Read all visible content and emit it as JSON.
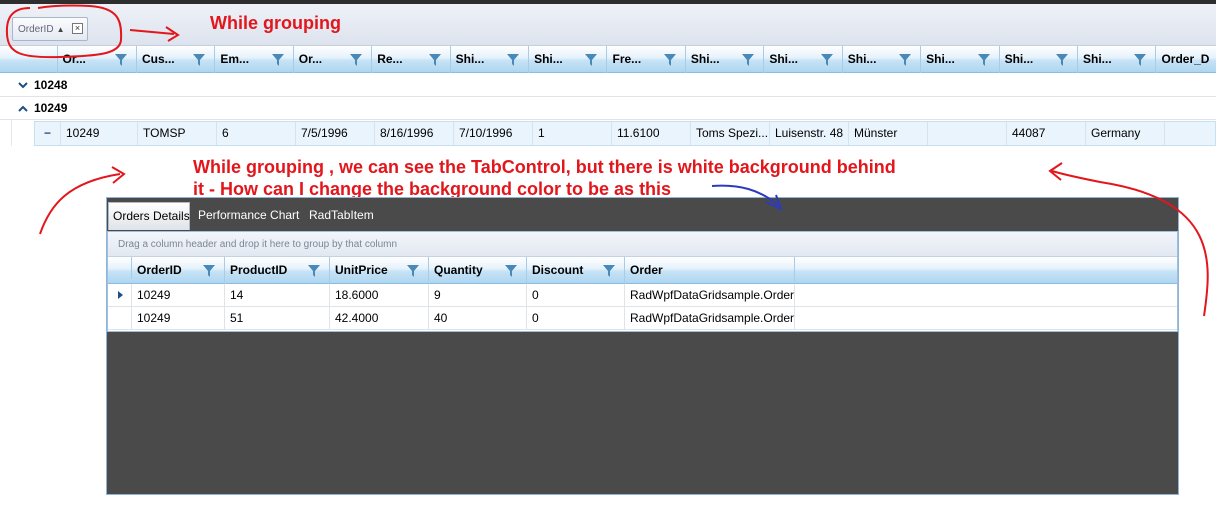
{
  "group_panel": {
    "chip_label": "OrderID",
    "chip_close": "×"
  },
  "columns": [
    "Or...",
    "Cus...",
    "Em...",
    "Or...",
    "Re...",
    "Shi...",
    "Shi...",
    "Fre...",
    "Shi...",
    "Shi...",
    "Shi...",
    "Shi...",
    "Shi...",
    "Shi...",
    "Order_D"
  ],
  "groups": [
    {
      "label": "10248",
      "expanded": false
    },
    {
      "label": "10249",
      "expanded": true
    }
  ],
  "expand_toggle": "−",
  "row": [
    "10249",
    "TOMSP",
    "6",
    "7/5/1996",
    "8/16/1996",
    "7/10/1996",
    "1",
    "11.6100",
    "Toms Spezi...",
    "Luisenstr. 48",
    "Münster",
    "",
    "44087",
    "Germany"
  ],
  "annotations": {
    "while_grouping": "While grouping",
    "question_line1": "While grouping , we can see the TabControl, but there is white background behind",
    "question_line2": "it - How can I change the background color to be as this"
  },
  "tabs": [
    "Orders Details",
    "Performance Chart",
    "RadTabItem"
  ],
  "inner_grid": {
    "drag_hint": "Drag a column header and drop it here to group by that column",
    "columns": [
      "OrderID",
      "ProductID",
      "UnitPrice",
      "Quantity",
      "Discount",
      "Order"
    ],
    "rows": [
      [
        "10249",
        "14",
        "18.6000",
        "9",
        "0",
        "RadWpfDataGridsample.Order"
      ],
      [
        "10249",
        "51",
        "42.4000",
        "40",
        "0",
        "RadWpfDataGridsample.Order"
      ]
    ]
  },
  "colors": {
    "annotation": "#e3161c",
    "arrow_blue": "#2b3bbd",
    "tab_background": "#4a4a4a",
    "header_gradient_end": "#aed6f1"
  }
}
